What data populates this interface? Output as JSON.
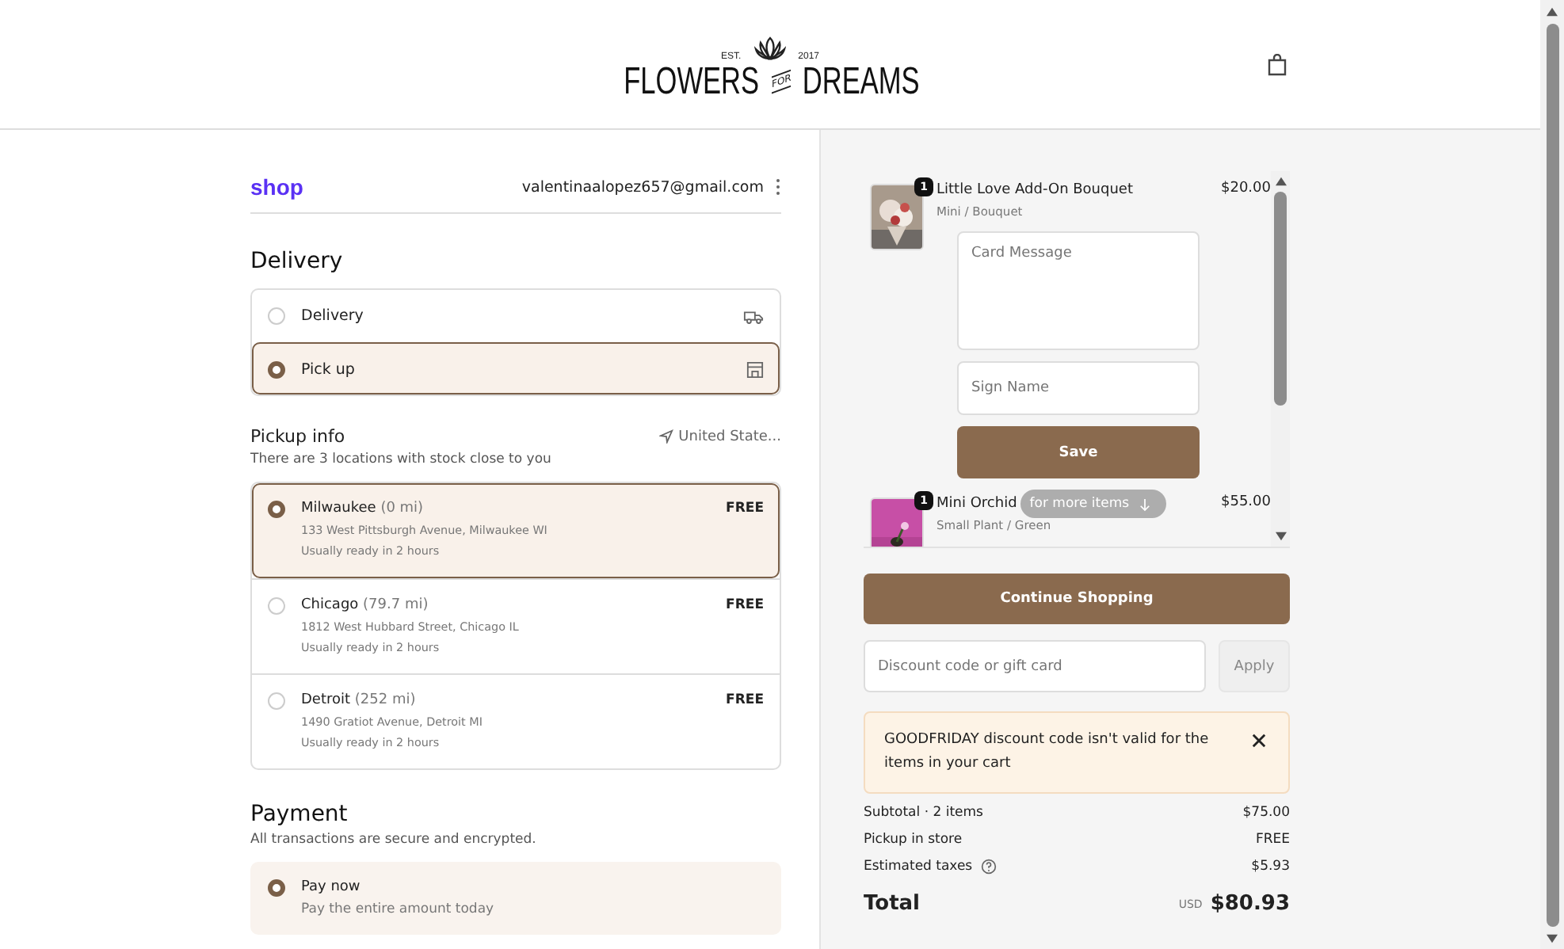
{
  "header": {
    "logo": {
      "est": "EST.",
      "year": "2017",
      "left": "FLOWERS",
      "middle": "FOR",
      "right": "DREAMS"
    }
  },
  "account": {
    "brand": "shop",
    "email": "valentinaalopez657@gmail.com"
  },
  "delivery": {
    "title": "Delivery",
    "options": [
      {
        "label": "Delivery",
        "kind": "truck",
        "selected": false
      },
      {
        "label": "Pick up",
        "kind": "store",
        "selected": true
      }
    ]
  },
  "pickup": {
    "title": "Pickup info",
    "location": "United State...",
    "subtitle": "There are 3 locations with stock close to you",
    "locations": [
      {
        "name": "Milwaukee",
        "distance": "(0 mi)",
        "address": "133 West Pittsburgh Avenue, Milwaukee WI",
        "ready": "Usually ready in 2 hours",
        "price": "FREE",
        "selected": true
      },
      {
        "name": "Chicago",
        "distance": "(79.7 mi)",
        "address": "1812 West Hubbard Street, Chicago IL",
        "ready": "Usually ready in 2 hours",
        "price": "FREE",
        "selected": false
      },
      {
        "name": "Detroit",
        "distance": "(252 mi)",
        "address": "1490 Gratiot Avenue, Detroit MI",
        "ready": "Usually ready in 2 hours",
        "price": "FREE",
        "selected": false
      }
    ]
  },
  "payment": {
    "title": "Payment",
    "subtitle": "All transactions are secure and encrypted.",
    "options": [
      {
        "label": "Pay now",
        "description": "Pay the entire amount today",
        "selected": true
      }
    ]
  },
  "cart": {
    "items": [
      {
        "quantity": "1",
        "name": "Little Love Add-On Bouquet",
        "variant": "Mini / Bouquet",
        "price": "$20.00",
        "card_form": {
          "message_placeholder": "Card Message",
          "sign_placeholder": "Sign Name",
          "save": "Save"
        }
      },
      {
        "quantity": "1",
        "name": "Mini Orchid",
        "variant": "Small Plant / Green",
        "price": "$55.00"
      }
    ],
    "scroll_hint": "for more items"
  },
  "continue_button": "Continue Shopping",
  "discount": {
    "placeholder": "Discount code or gift card",
    "apply": "Apply"
  },
  "alert": {
    "message": "GOODFRIDAY discount code isn't valid for the items in your cart"
  },
  "summary": {
    "rows": [
      {
        "label": "Subtotal · 2 items",
        "value": "$75.00",
        "kind": "plain"
      },
      {
        "label": "Pickup in store",
        "value": "FREE",
        "kind": "plain"
      },
      {
        "label": "Estimated taxes",
        "value": "$5.93",
        "kind": "help"
      }
    ],
    "total": {
      "label": "Total",
      "currency": "USD",
      "value": "$80.93"
    }
  }
}
